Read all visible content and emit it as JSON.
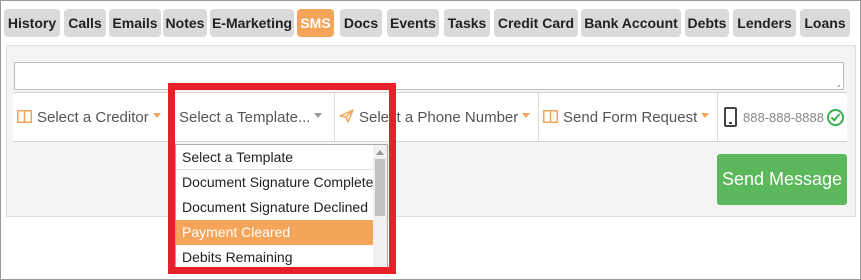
{
  "tabs": [
    {
      "label": "History"
    },
    {
      "label": "Calls"
    },
    {
      "label": "Emails"
    },
    {
      "label": "Notes"
    },
    {
      "label": "E-Marketing"
    },
    {
      "label": "SMS",
      "active": true
    },
    {
      "label": "Docs"
    },
    {
      "label": "Events"
    },
    {
      "label": "Tasks"
    },
    {
      "label": "Credit Card"
    },
    {
      "label": "Bank Account"
    },
    {
      "label": "Debts"
    },
    {
      "label": "Lenders"
    },
    {
      "label": "Loans"
    }
  ],
  "message_input": {
    "value": "",
    "placeholder": ""
  },
  "toolbar": {
    "creditor_select": {
      "label": "Select a Creditor",
      "icon": "columns-icon"
    },
    "template_select": {
      "label": "Select a Template..."
    },
    "phone_select": {
      "label": "Select a Phone Number",
      "icon": "paper-plane-icon"
    },
    "form_request_select": {
      "label": "Send Form Request",
      "icon": "columns-icon"
    },
    "phone_display": {
      "number": "888-888-8888",
      "icon": "mobile-phone-icon",
      "status_icon": "check-circle-icon"
    }
  },
  "template_dropdown": {
    "options": [
      {
        "label": "Select a Template"
      },
      {
        "label": "Document Signature Complete"
      },
      {
        "label": "Document Signature Declined"
      },
      {
        "label": "Payment Cleared",
        "highlighted": true
      },
      {
        "label": "Debits Remaining"
      }
    ]
  },
  "send_button": {
    "label": "Send Message"
  },
  "colors": {
    "accent": "#f5a55a",
    "tab_bg": "#dadada",
    "send_button": "#5cb85c",
    "highlight_outline": "#e8202a",
    "check": "#3cae4e"
  }
}
